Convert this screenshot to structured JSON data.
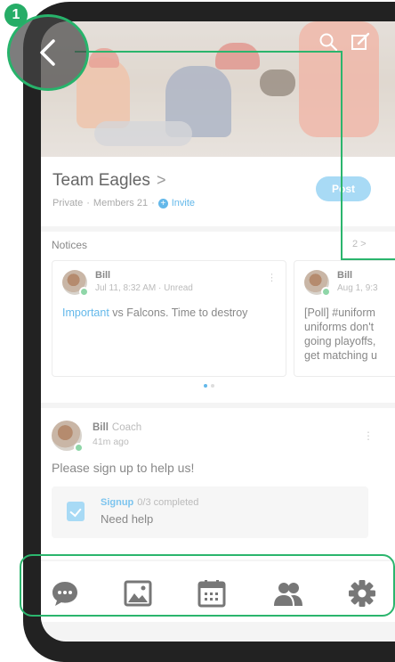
{
  "step_badge": "1",
  "colors": {
    "accent": "#63b8ea",
    "highlight": "#2bb56d",
    "badge": "#26ad67"
  },
  "hero": {
    "icons": [
      "search-icon",
      "compose-icon"
    ],
    "back_icon": "chevron-left-icon"
  },
  "team": {
    "name": "Team Eagles",
    "chevron": ">",
    "privacy": "Private",
    "separator": "·",
    "members": "Members 21",
    "invite": "Invite",
    "invite_icon_glyph": "+",
    "post_button": "Post"
  },
  "notices": {
    "title": "Notices",
    "count": "2 >",
    "items": [
      {
        "author": "Bill",
        "date": "Jul 11, 8:32 AM · Unread",
        "tag": "Important",
        "text": " vs Falcons. Time to destroy"
      },
      {
        "author": "Bill",
        "date": "Aug 1, 9:3",
        "tag": "",
        "text": "[Poll] #uniform uniforms don't going playoffs, get matching u"
      }
    ],
    "more_glyph": "⋮",
    "page_index": 0
  },
  "post": {
    "author": "Bill",
    "role": "Coach",
    "time": "41m ago",
    "text": "Please sign up to help us!",
    "more_glyph": "⋮",
    "signup": {
      "label": "Signup",
      "progress": "0/3 completed",
      "subtitle": "Need help"
    }
  },
  "tabbar": {
    "items": [
      "chat-icon",
      "photo-icon",
      "calendar-icon",
      "members-icon",
      "settings-icon"
    ]
  }
}
